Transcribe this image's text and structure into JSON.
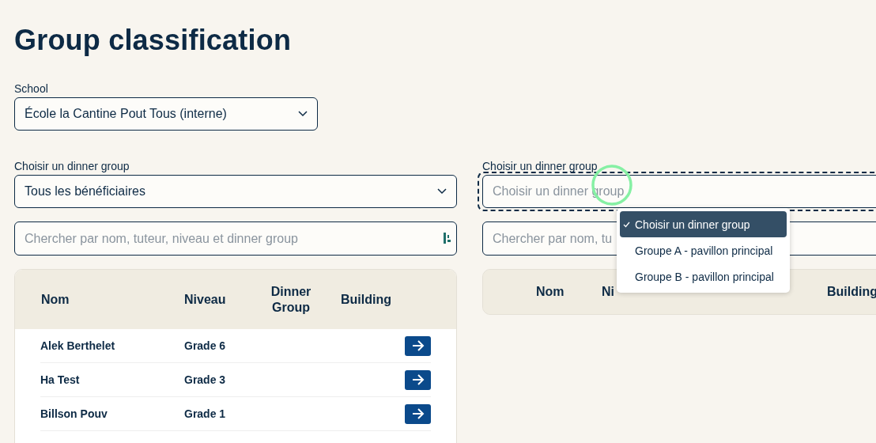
{
  "title": "Group classification",
  "school": {
    "label": "School",
    "value": "École la Cantine Pout Tous (interne)"
  },
  "left": {
    "filter": {
      "label": "Choisir un dinner group",
      "value": "Tous les bénéficiaires"
    },
    "search": {
      "placeholder": "Chercher par nom, tuteur, niveau et dinner group"
    },
    "table": {
      "columns": [
        "Nom",
        "Niveau",
        "Dinner Group",
        "Building"
      ],
      "rows": [
        {
          "name": "Alek Berthelet",
          "level": "Grade 6"
        },
        {
          "name": "Ha Test",
          "level": "Grade 3"
        },
        {
          "name": "Billson Pouv",
          "level": "Grade 1"
        }
      ]
    }
  },
  "right": {
    "filter": {
      "label": "Choisir un dinner group",
      "placeholder": "Choisir un dinner group",
      "focused": true
    },
    "search": {
      "placeholder": "Chercher par nom, tu"
    },
    "table": {
      "columns": [
        "Nom",
        "Ni",
        "Building"
      ]
    },
    "menu": [
      {
        "label": "Choisir un dinner group",
        "selected": true
      },
      {
        "label": "Groupe A - pavillon principal",
        "selected": false
      },
      {
        "label": "Groupe B - pavillon principal",
        "selected": false
      }
    ]
  }
}
